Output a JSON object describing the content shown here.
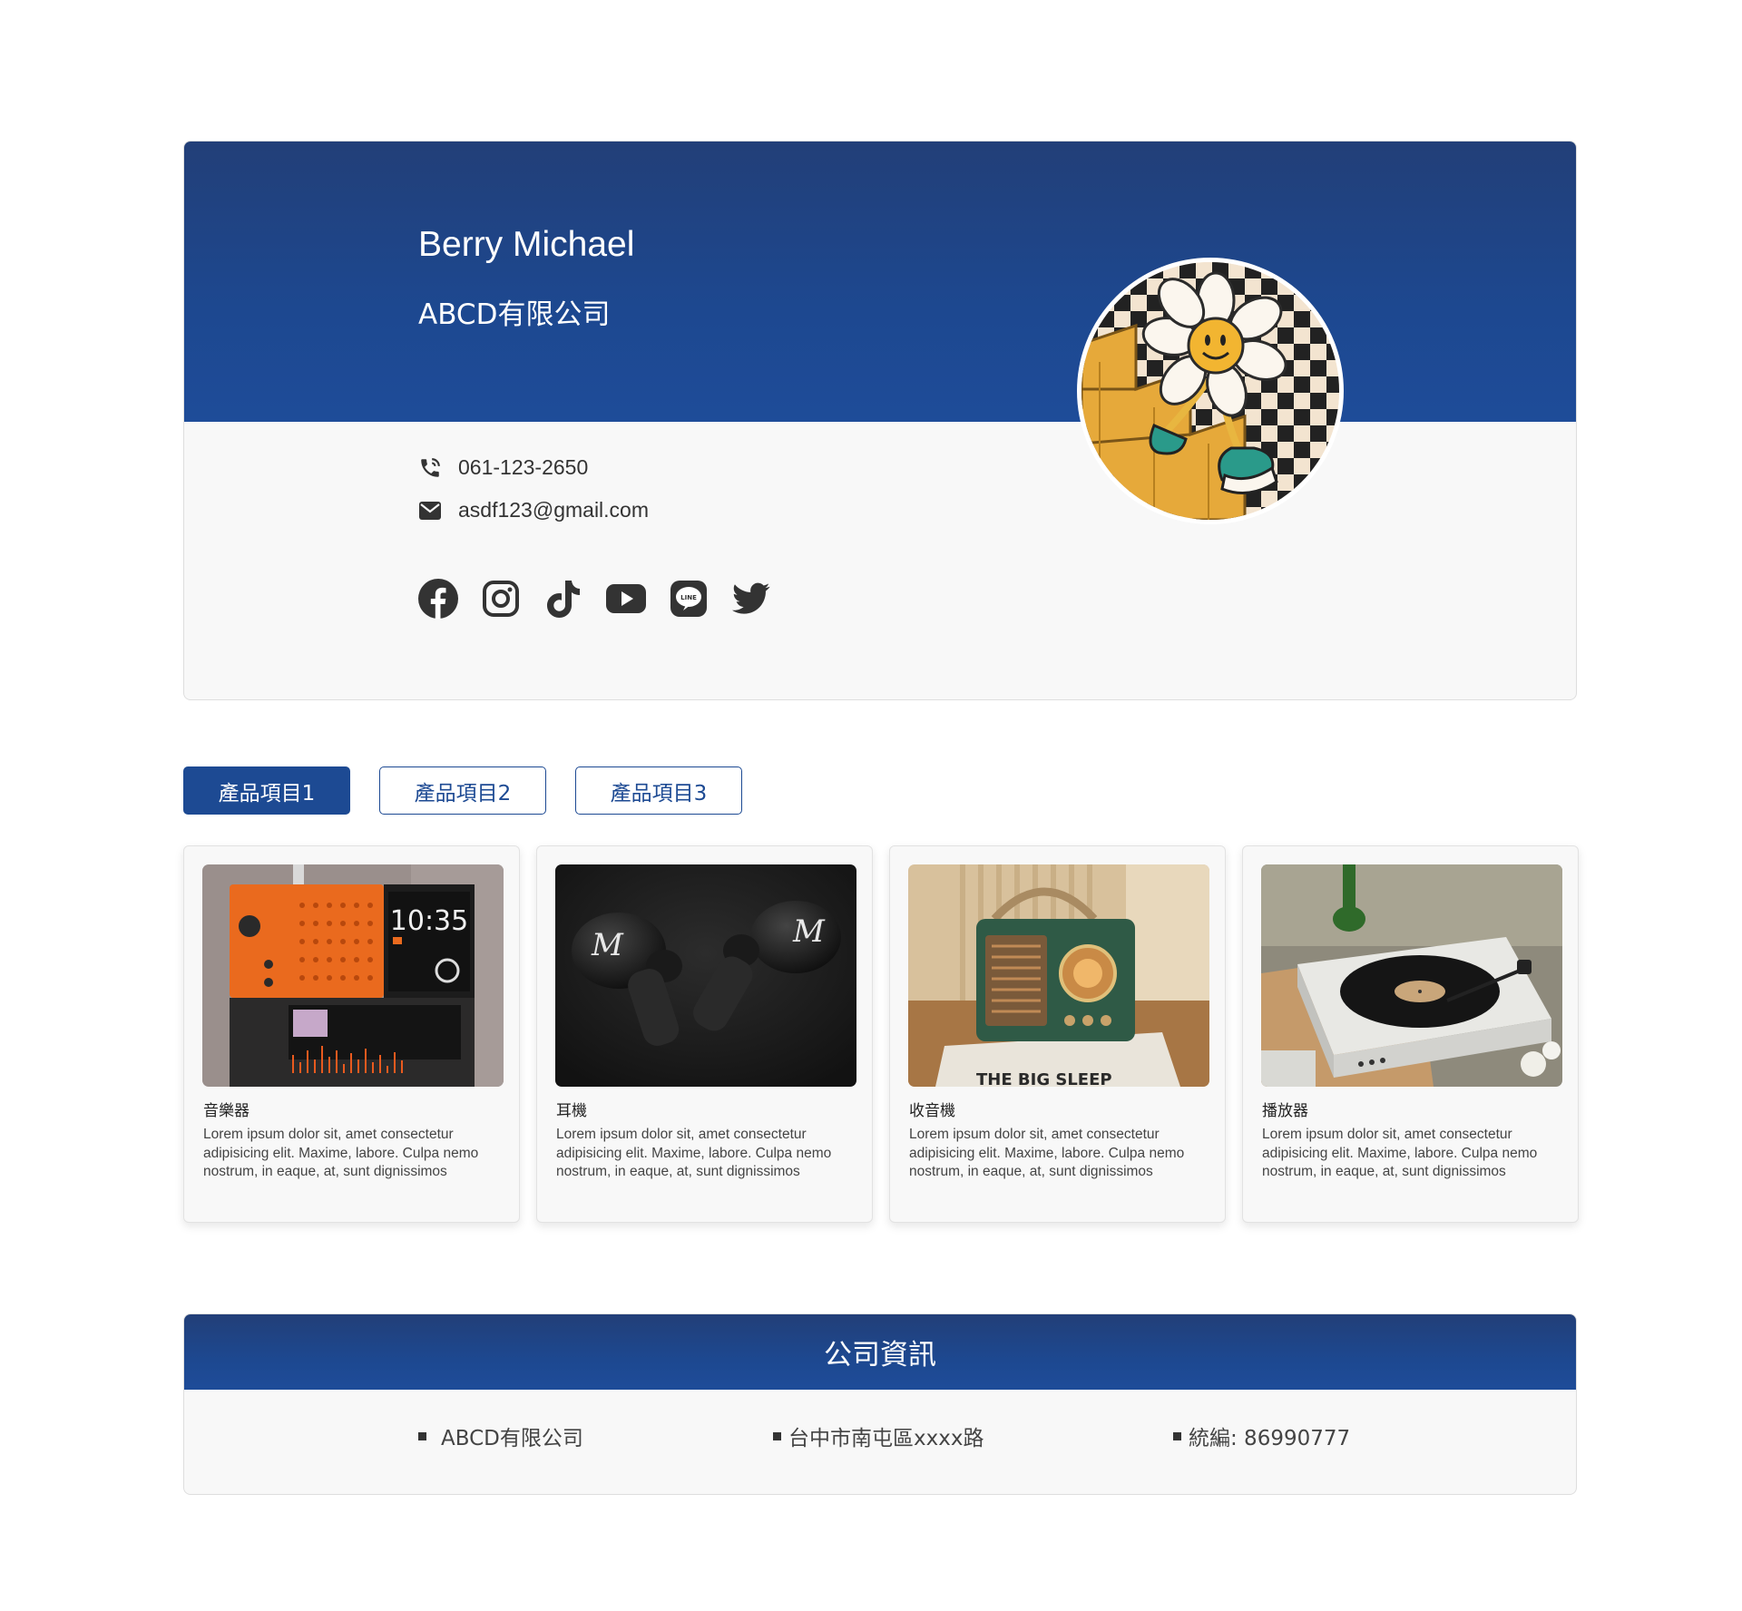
{
  "profile": {
    "name": "Berry Michael",
    "company": "ABCD有限公司",
    "phone": "061-123-2650",
    "email": "asdf123@gmail.com",
    "social": [
      "facebook-icon",
      "instagram-icon",
      "tiktok-icon",
      "youtube-icon",
      "line-icon",
      "twitter-icon"
    ],
    "accent_color": "#1d4a93"
  },
  "tabs": [
    {
      "label": "產品項目1",
      "active": true
    },
    {
      "label": "產品項目2",
      "active": false
    },
    {
      "label": "產品項目3",
      "active": false
    }
  ],
  "products": [
    {
      "title": "音樂器",
      "description": "Lorem ipsum dolor sit, amet consectetur adipisicing elit. Maxime, labore. Culpa nemo nostrum, in eaque, at, sunt dignissimos"
    },
    {
      "title": "耳機",
      "description": "Lorem ipsum dolor sit, amet consectetur adipisicing elit. Maxime, labore. Culpa nemo nostrum, in eaque, at, sunt dignissimos"
    },
    {
      "title": "收音機",
      "description": "Lorem ipsum dolor sit, amet consectetur adipisicing elit. Maxime, labore. Culpa nemo nostrum, in eaque, at, sunt dignissimos"
    },
    {
      "title": "播放器",
      "description": "Lorem ipsum dolor sit, amet consectetur adipisicing elit. Maxime, labore. Culpa nemo nostrum, in eaque, at, sunt dignissimos"
    }
  ],
  "company_info": {
    "heading": "公司資訊",
    "items": [
      "ABCD有限公司",
      "台中市南屯區xxxx路",
      "統編: 86990777"
    ]
  }
}
